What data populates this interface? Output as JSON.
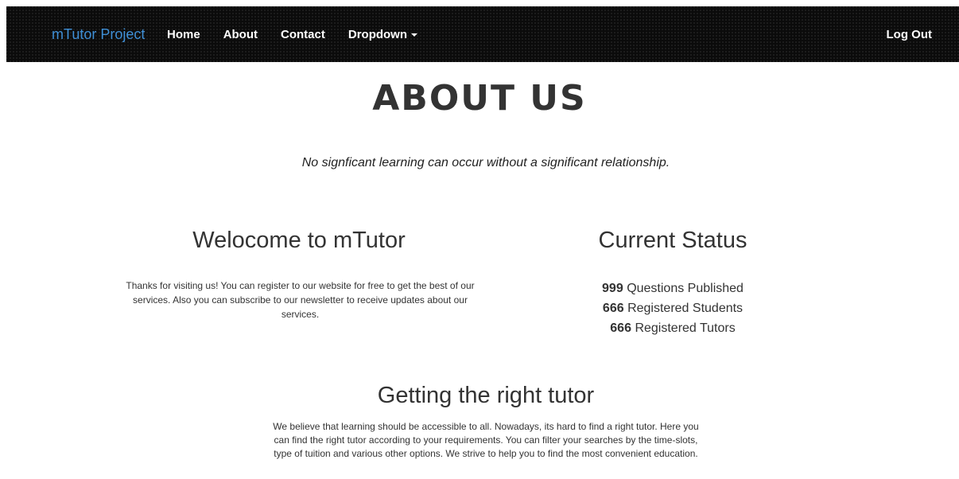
{
  "navbar": {
    "brand": "mTutor Project",
    "links": [
      "Home",
      "About",
      "Contact",
      "Dropdown"
    ],
    "logout": "Log Out"
  },
  "page": {
    "title": "ABOUT US",
    "quote": "No signficant learning can occur without a significant relationship."
  },
  "welcome": {
    "heading": "Welocome to mTutor",
    "text": "Thanks for visiting us! You can register to our website for free to get the best of our services. Also you can subscribe to our newsletter to receive updates about our services."
  },
  "status": {
    "heading": "Current Status",
    "items": [
      {
        "count": "999",
        "label": "Questions Published"
      },
      {
        "count": "666",
        "label": "Registered Students"
      },
      {
        "count": "666",
        "label": "Registered Tutors"
      }
    ]
  },
  "tutor": {
    "heading": "Getting the right tutor",
    "text": "We believe that learning should be accessible to all. Nowadays, its hard to find a right tutor. Here you can find the right tutor according to your requirements. You can filter your searches by the time-slots, type of tuition and various other options. We strive to help you to find the most convenient education."
  }
}
